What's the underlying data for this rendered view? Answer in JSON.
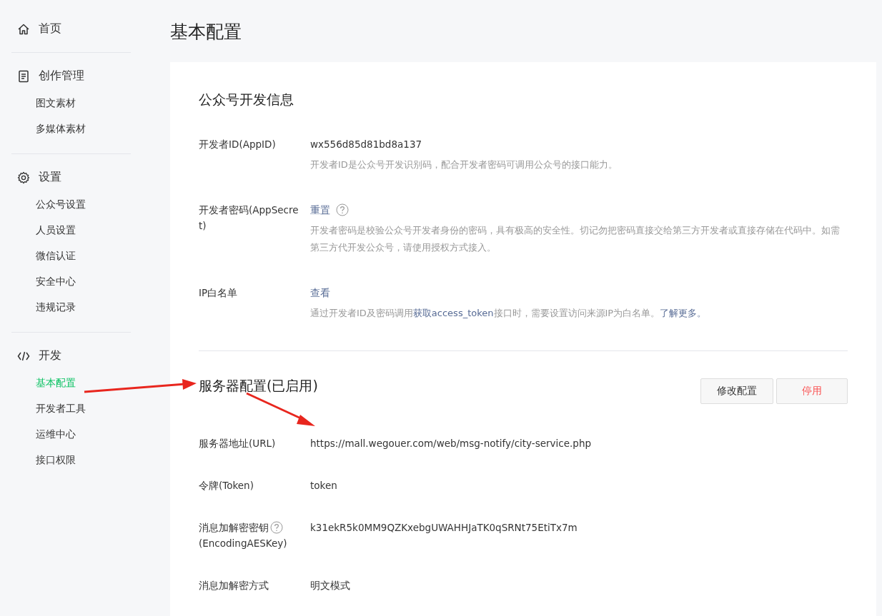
{
  "sidebar": {
    "sections": [
      {
        "title": "首页"
      },
      {
        "title": "创作管理",
        "items": [
          {
            "label": "图文素材",
            "selected": false
          },
          {
            "label": "多媒体素材",
            "selected": false
          }
        ]
      },
      {
        "title": "设置",
        "items": [
          {
            "label": "公众号设置",
            "selected": false
          },
          {
            "label": "人员设置",
            "selected": false
          },
          {
            "label": "微信认证",
            "selected": false
          },
          {
            "label": "安全中心",
            "selected": false
          },
          {
            "label": "违规记录",
            "selected": false
          }
        ]
      },
      {
        "title": "开发",
        "items": [
          {
            "label": "基本配置",
            "selected": true
          },
          {
            "label": "开发者工具",
            "selected": false
          },
          {
            "label": "运维中心",
            "selected": false
          },
          {
            "label": "接口权限",
            "selected": false
          }
        ]
      }
    ]
  },
  "page_title": "基本配置",
  "dev_info": {
    "title": "公众号开发信息",
    "rows": [
      {
        "label": "开发者ID(AppID)",
        "value": "wx556d85d81bd8a137",
        "help": false,
        "value_is_link": false,
        "description": [
          {
            "text": "开发者ID是公众号开发识别码，配合开发者密码可调用公众号的接口能力。",
            "link": false
          }
        ]
      },
      {
        "label": "开发者密码(AppSecret)",
        "value": "重置",
        "help": true,
        "value_is_link": true,
        "description": [
          {
            "text": "开发者密码是校验公众号开发者身份的密码，具有极高的安全性。切记勿把密码直接交给第三方开发者或直接存储在代码中。如需第三方代开发公众号，请使用授权方式接入。",
            "link": false
          }
        ]
      },
      {
        "label": "IP白名单",
        "value": "查看",
        "help": false,
        "value_is_link": true,
        "description": [
          {
            "text": "通过开发者ID及密码调用",
            "link": false
          },
          {
            "text": "获取access_token",
            "link": true
          },
          {
            "text": "接口时，需要设置访问来源IP为白名单。",
            "link": false
          },
          {
            "text": "了解更多。",
            "link": true
          }
        ]
      }
    ]
  },
  "server_config": {
    "title": "服务器配置(已启用)",
    "buttons": [
      {
        "label": "修改配置",
        "kind": "normal"
      },
      {
        "label": "停用",
        "kind": "danger"
      }
    ],
    "rows": [
      {
        "label": "服务器地址(URL)",
        "value": "https://mall.wegouer.com/web/msg-notify/city-service.php",
        "help": false
      },
      {
        "label": "令牌(Token)",
        "value": "token",
        "help": false
      },
      {
        "label": "消息加解密密钥",
        "label_2": "(EncodingAESKey)",
        "value": "k31ekR5k0MM9QZKxebgUWAHHJaTK0qSRNt75EtiTx7m",
        "help": true
      },
      {
        "label": "消息加解密方式",
        "value": "明文模式",
        "help": false
      }
    ]
  }
}
